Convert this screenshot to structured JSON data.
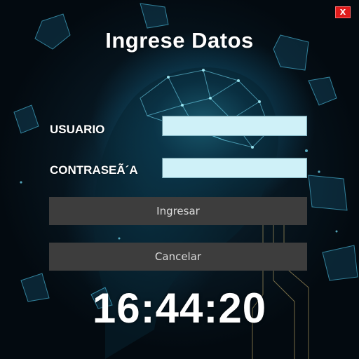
{
  "window": {
    "close_label": "X",
    "title": "Ingrese Datos"
  },
  "form": {
    "user_label": "USUARIO",
    "user_value": "",
    "password_label": "CONTRASEÃ´A",
    "password_value": ""
  },
  "buttons": {
    "login_label": "Ingresar",
    "cancel_label": "Cancelar"
  },
  "clock": {
    "time": "16:44:20"
  },
  "colors": {
    "button_bg": "#3d3d3d",
    "input_bg": "#cff1f8",
    "close_bg": "#e01b1b",
    "accent_cyan": "#3cc8e8"
  }
}
